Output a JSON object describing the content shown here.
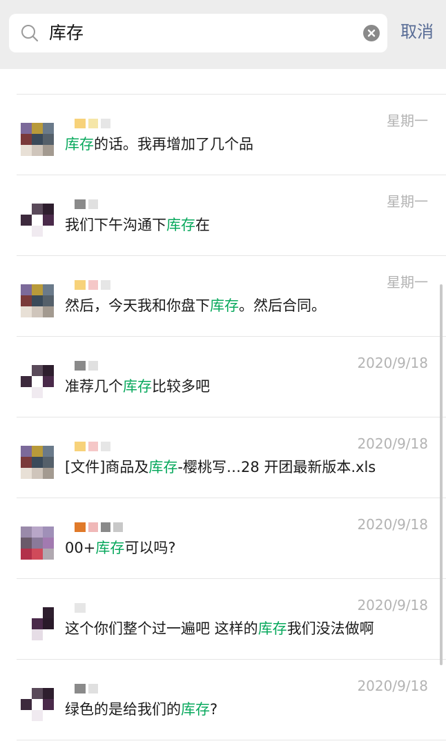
{
  "search": {
    "query": "库存",
    "cancel_label": "取消"
  },
  "colors": {
    "highlight": "#07a85c",
    "cancel": "#576b95",
    "time": "#b3b3b3"
  },
  "results": [
    {
      "time": "星期一",
      "pre": "",
      "hit": "库存",
      "post": "的话。我再增加了几个品",
      "avatar": [
        "#f3f3f3",
        "#fde7b8",
        "#fff",
        "#7c6a9a",
        "#b89a3a",
        "#6a7a8a",
        "#7a3a3a",
        "#3a4a5a",
        "#55606a",
        "#e8e0d6",
        "#cfc5bb",
        "#a39a90"
      ],
      "name": [
        "#f7d27a",
        "#f5e6a8",
        "#e6e6e6"
      ]
    },
    {
      "time": "星期一",
      "pre": "我们下午沟通下",
      "hit": "库存",
      "post": "在",
      "avatar": [
        "#ffffff",
        "#5a4a5a",
        "#2e1e2e",
        "#3d2a3d",
        "#ffffff",
        "#4a2a4a",
        "#ffffff",
        "#f0eaf0",
        "#ffffff"
      ],
      "name": [
        "#8a8a8a",
        "#e0e0e0"
      ]
    },
    {
      "time": "星期一",
      "pre": "然后，今天我和你盘下",
      "hit": "库存",
      "post": "。然后合同。",
      "avatar": [
        "#7c6a9a",
        "#b89a3a",
        "#6a7a8a",
        "#7a3a3a",
        "#3a4a5a",
        "#55606a",
        "#e8e0d6",
        "#cfc5bb",
        "#a39a90"
      ],
      "name": [
        "#f7d27a",
        "#f5c7c7",
        "#e6e6e6"
      ]
    },
    {
      "time": "2020/9/18",
      "pre": "准荐几个",
      "hit": "库存",
      "post": "比较多吧",
      "avatar": [
        "#ffffff",
        "#5a4a5a",
        "#2e1e2e",
        "#3d2a3d",
        "#ffffff",
        "#4a2a4a",
        "#ffffff",
        "#f0eaf0",
        "#ffffff"
      ],
      "name": [
        "#8a8a8a",
        "#e0e0e0"
      ]
    },
    {
      "time": "2020/9/18",
      "pre": "[文件]商品及",
      "hit": "库存",
      "post": "-樱桃写…28 开团最新版本.xls",
      "avatar": [
        "#7c6a9a",
        "#b89a3a",
        "#6a7a8a",
        "#7a3a3a",
        "#3a4a5a",
        "#55606a",
        "#e8e0d6",
        "#cfc5bb",
        "#a39a90"
      ],
      "name": [
        "#f7d27a",
        "#f5c7c7",
        "#e6e6e6"
      ]
    },
    {
      "time": "2020/9/18",
      "pre": "00+",
      "hit": "库存",
      "post": "可以吗?",
      "avatar": [
        "#9a8aaa",
        "#b8a6c8",
        "#a090b8",
        "#6a5a6a",
        "#8a7a9a",
        "#a27ab0",
        "#b2304a",
        "#d04a5a",
        "#b0a8b0"
      ],
      "name": [
        "#e07a2a",
        "#f0b8b8",
        "#8a8a8a",
        "#c8c8c8"
      ]
    },
    {
      "time": "2020/9/18",
      "pre": "这个你们整个过一遍吧 这样的",
      "hit": "库存",
      "post": "我们没法做啊",
      "avatar": [
        "#ffffff",
        "#ffffff",
        "#2e1e2e",
        "#ffffff",
        "#4a2a4a",
        "#2a1a2a",
        "#ffffff",
        "#e6dde6",
        "#ffffff"
      ],
      "name": [
        "#e6e6e6"
      ]
    },
    {
      "time": "2020/9/18",
      "pre": "绿色的是给我们的",
      "hit": "库存",
      "post": "?",
      "avatar": [
        "#ffffff",
        "#5a4a5a",
        "#2e1e2e",
        "#3d2a3d",
        "#ffffff",
        "#4a2a4a",
        "#ffffff",
        "#f0eaf0",
        "#ffffff"
      ],
      "name": [
        "#8a8a8a",
        "#e0e0e0"
      ]
    }
  ]
}
